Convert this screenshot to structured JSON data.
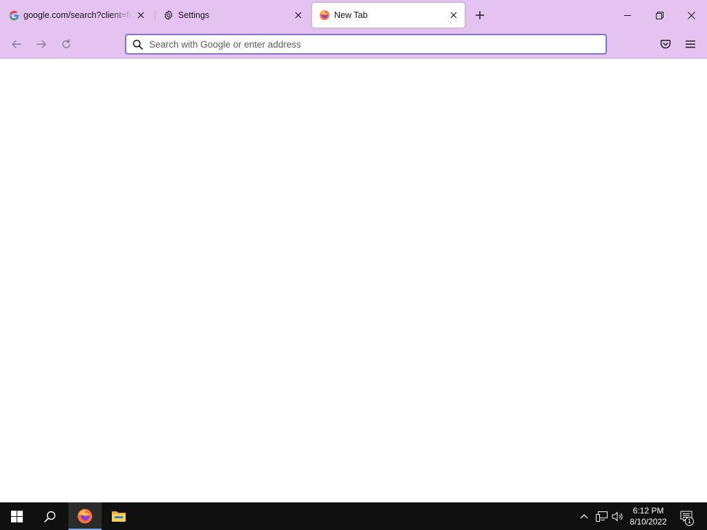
{
  "browser": {
    "tabs": [
      {
        "title": "google.com/search?client=firefox",
        "icon": "google-icon",
        "active": false
      },
      {
        "title": "Settings",
        "icon": "gear-icon",
        "active": false
      },
      {
        "title": "New Tab",
        "icon": "firefox-icon",
        "active": true
      }
    ],
    "urlbar": {
      "placeholder": "Search with Google or enter address",
      "value": ""
    }
  },
  "taskbar": {
    "time": "6:12 PM",
    "date": "8/10/2022",
    "notification_count": "1"
  },
  "colors": {
    "tabstrip_bg": "#e4c3f1",
    "urlbar_focus": "#7a73d9",
    "taskbar_bg": "#101010",
    "active_indicator": "#7aa7e0"
  }
}
